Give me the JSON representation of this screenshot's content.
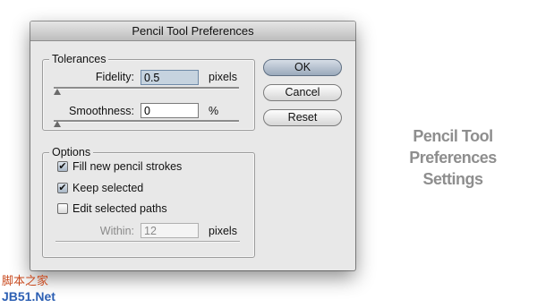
{
  "dialog": {
    "title": "Pencil Tool Preferences",
    "tolerances": {
      "legend": "Tolerances",
      "fidelity_label": "Fidelity:",
      "fidelity_value": "0.5",
      "fidelity_unit": "pixels",
      "smoothness_label": "Smoothness:",
      "smoothness_value": "0",
      "smoothness_unit": "%"
    },
    "options": {
      "legend": "Options",
      "fill_new_pencil_strokes": {
        "label": "Fill new pencil strokes",
        "checked": true
      },
      "keep_selected": {
        "label": "Keep selected",
        "checked": true
      },
      "edit_selected_paths": {
        "label": "Edit selected paths",
        "checked": false
      },
      "within_label": "Within:",
      "within_value": "12",
      "within_unit": "pixels"
    },
    "buttons": {
      "ok": "OK",
      "cancel": "Cancel",
      "reset": "Reset"
    }
  },
  "caption": {
    "line1": "Pencil Tool",
    "line2": "Preferences",
    "line3": "Settings"
  },
  "watermark": {
    "line1": "脚本之家",
    "line2": "JB51.Net"
  },
  "colors": {
    "focused_field": "#c6d3df",
    "caption_gray": "#8e8e8e",
    "watermark_orange": "#c8491e",
    "watermark_blue": "#2c5fb3"
  }
}
